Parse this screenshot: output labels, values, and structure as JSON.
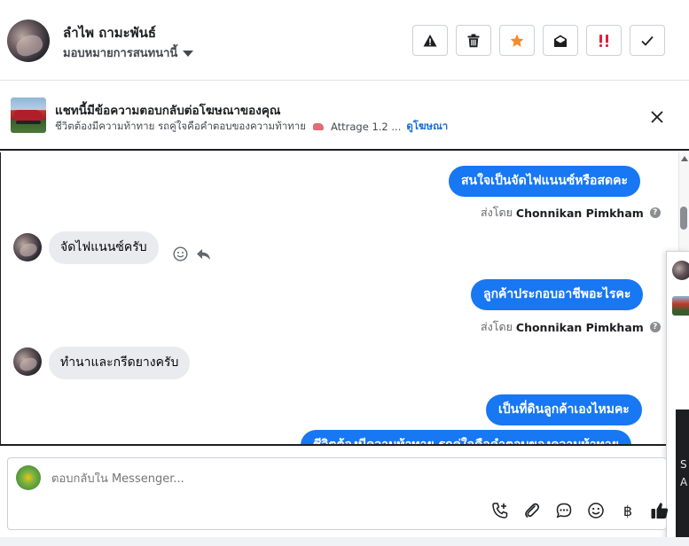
{
  "header": {
    "contact_name": "ลำไพ ถามะพันธ์",
    "assign_label": "มอบหมายการสนทนานี้",
    "actions": [
      {
        "icon": "warning-icon"
      },
      {
        "icon": "trash-icon"
      },
      {
        "icon": "star-icon"
      },
      {
        "icon": "envelope-open-icon"
      },
      {
        "icon": "important-icon"
      },
      {
        "icon": "check-icon"
      }
    ],
    "colors": {
      "star": "#f28b2a",
      "important": "#e41e3f"
    }
  },
  "ad": {
    "title": "แชทนี้มีข้อความตอบกลับต่อโฆษณาของคุณ",
    "subtitle": "ชีวิตต้องมีความท้าทาย รถคู่ใจคือคำตอบของความท้าทาย",
    "car_model": "Attrage 1.2 ...",
    "link": "ดูโฆษณา"
  },
  "messages": [
    {
      "direction": "out",
      "text": "สนใจเป็นจัดไฟแนนซ์หรือสดคะ",
      "sent_by_prefix": "ส่งโดย",
      "sender": "Chonnikan Pimkham"
    },
    {
      "direction": "in",
      "text": "จัดไฟแนนซ์ครับ"
    },
    {
      "direction": "out",
      "text": "ลูกค้าประกอบอาชีพอะไรคะ",
      "sent_by_prefix": "ส่งโดย",
      "sender": "Chonnikan Pimkham"
    },
    {
      "direction": "in",
      "text": "ทำนาและกรีดยางครับ"
    },
    {
      "direction": "out",
      "text": "เป็นที่ดินลูกค้าเองไหมคะ"
    },
    {
      "direction": "out",
      "text": "ชีวิตต้องมีความท้าทาย รถคู่ใจคือคำตอบของความท้าทาย"
    }
  ],
  "side_panel": {
    "text_1": "S",
    "text_2": "A"
  },
  "composer": {
    "placeholder": "ตอบกลับใน Messenger...",
    "tools": [
      "call-add-icon",
      "attachment-icon",
      "saved-replies-icon",
      "emoji-icon",
      "baht-icon",
      "like-icon"
    ],
    "baht_symbol": "฿"
  },
  "colors": {
    "accent": "#1877f2",
    "incoming_bubble": "#e9ebee"
  }
}
